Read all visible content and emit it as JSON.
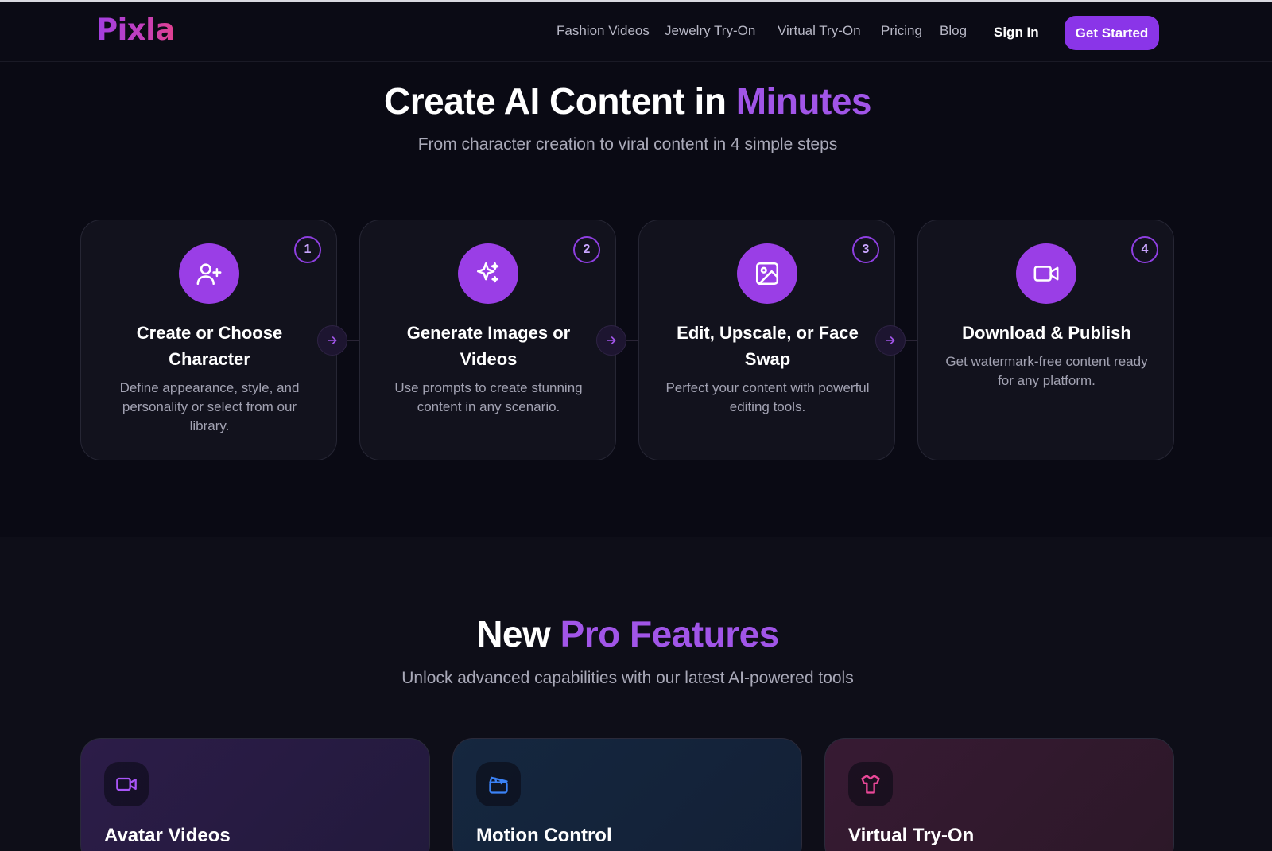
{
  "brand": {
    "name": "Pixla"
  },
  "nav": {
    "links": [
      "Fashion Videos",
      "Jewelry Try-On",
      "Virtual Try-On",
      "Pricing",
      "Blog"
    ],
    "sign_in": "Sign In",
    "get_started": "Get Started"
  },
  "how_it_works": {
    "title_main": "Create AI Content in",
    "title_accent": "Minutes",
    "subtitle": "From character creation to viral content in 4 simple steps",
    "steps": [
      {
        "number": "1",
        "icon": "user-plus-icon",
        "title": "Create or Choose Character",
        "description": "Define appearance, style, and personality or select from our library."
      },
      {
        "number": "2",
        "icon": "sparkles-icon",
        "title": "Generate Images or Videos",
        "description": "Use prompts to create stunning content in any scenario."
      },
      {
        "number": "3",
        "icon": "image-icon",
        "title": "Edit, Upscale, or Face Swap",
        "description": "Perfect your content with powerful editing tools."
      },
      {
        "number": "4",
        "icon": "video-icon",
        "title": "Download & Publish",
        "description": "Get watermark-free content ready for any platform."
      }
    ]
  },
  "pro_features": {
    "title_main": "New",
    "title_accent": "Pro Features",
    "subtitle": "Unlock advanced capabilities with our latest AI-powered tools",
    "cards": [
      {
        "title": "Avatar Videos",
        "icon": "video-camera-icon",
        "icon_color": "#a855f7"
      },
      {
        "title": "Motion Control",
        "icon": "clapperboard-icon",
        "icon_color": "#3b82f6"
      },
      {
        "title": "Virtual Try-On",
        "icon": "shirt-icon",
        "icon_color": "#ec4899"
      }
    ]
  },
  "colors": {
    "accent": "#a155e8",
    "button": "#8a35e8",
    "background": "#0a0a14"
  }
}
